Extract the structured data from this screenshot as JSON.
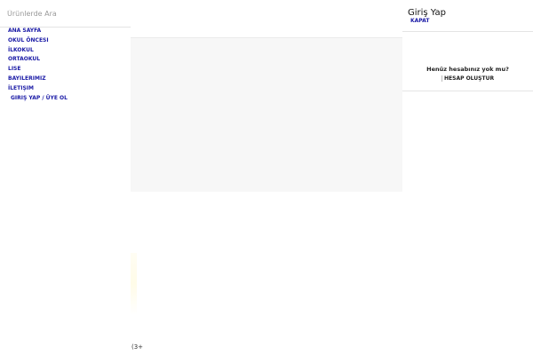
{
  "search": {
    "placeholder": "Ürünlerde Ara"
  },
  "nav": {
    "items": [
      {
        "label": "ANA SAYFA"
      },
      {
        "label": "OKUL ÖNCESI"
      },
      {
        "label": "İLKOKUL"
      },
      {
        "label": "ORTAOKUL"
      },
      {
        "label": "LISE"
      },
      {
        "label": "BAYILERIMIZ"
      },
      {
        "label": "İLETIŞIM"
      },
      {
        "label": "GIRIŞ YAP / ÜYE OL"
      }
    ]
  },
  "login": {
    "title": "Giriş Yap",
    "close_label": "KAPAT",
    "register_question": "Henüz hesabınız yok mu?",
    "register_button": "HESAP OLUŞTUR"
  },
  "footer": {
    "partial_text": "(3+"
  }
}
